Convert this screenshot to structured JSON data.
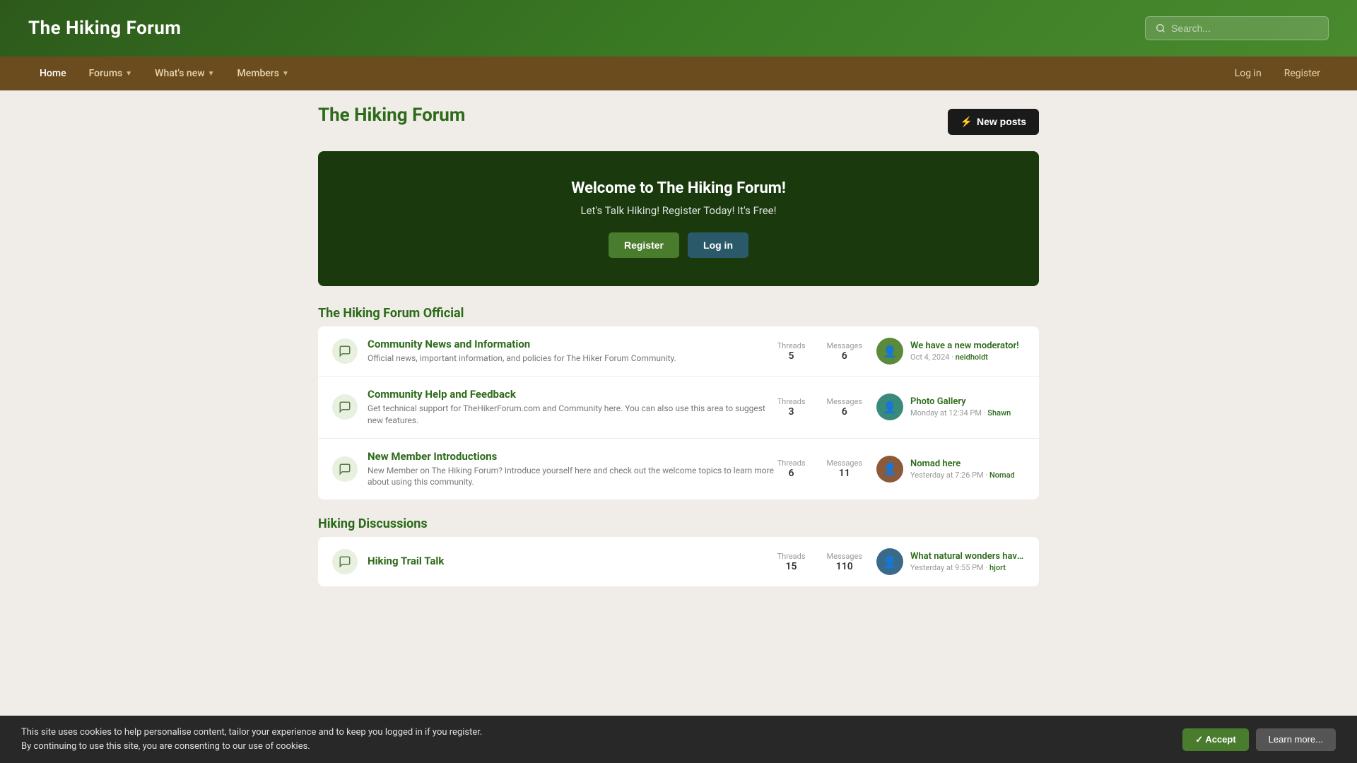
{
  "site": {
    "title": "The Hiking Forum",
    "search_placeholder": "Search..."
  },
  "nav": {
    "items": [
      {
        "id": "home",
        "label": "Home",
        "has_dropdown": false
      },
      {
        "id": "forums",
        "label": "Forums",
        "has_dropdown": true
      },
      {
        "id": "whats_new",
        "label": "What's new",
        "has_dropdown": true
      },
      {
        "id": "members",
        "label": "Members",
        "has_dropdown": true
      }
    ],
    "login_label": "Log in",
    "register_label": "Register"
  },
  "page": {
    "title": "The Hiking Forum",
    "new_posts_label": "New posts"
  },
  "welcome": {
    "heading": "Welcome to The Hiking Forum!",
    "subtext": "Let's Talk Hiking! Register Today! It's Free!",
    "register_label": "Register",
    "login_label": "Log in"
  },
  "sections": [
    {
      "id": "official",
      "title": "The Hiking Forum Official",
      "forums": [
        {
          "id": "community-news",
          "name": "Community News and Information",
          "description": "Official news, important information, and policies for The Hiker Forum Community.",
          "threads": 5,
          "messages": 6,
          "latest_title": "We have a new moderator!",
          "latest_date": "Oct 4, 2024",
          "latest_user": "neidholdt",
          "avatar_color": "green",
          "avatar_glyph": "👤"
        },
        {
          "id": "community-help",
          "name": "Community Help and Feedback",
          "description": "Get technical support for TheHikerForum.com and Community here. You can also use this area to suggest new features.",
          "threads": 3,
          "messages": 6,
          "latest_title": "Photo Gallery",
          "latest_date": "Monday at 12:34 PM",
          "latest_user": "Shawn",
          "avatar_color": "teal",
          "avatar_glyph": "👤"
        },
        {
          "id": "new-member",
          "name": "New Member Introductions",
          "description": "New Member on The Hiking Forum? Introduce yourself here and check out the welcome topics to learn more about using this community.",
          "threads": 6,
          "messages": 11,
          "latest_title": "Nomad here",
          "latest_date": "Yesterday at 7:26 PM",
          "latest_user": "Nomad",
          "avatar_color": "brown",
          "avatar_glyph": "👤"
        }
      ]
    },
    {
      "id": "discussions",
      "title": "Hiking Discussions",
      "forums": [
        {
          "id": "hiking-trail-talk",
          "name": "Hiking Trail Talk",
          "description": "",
          "threads": 15,
          "messages": 110,
          "latest_title": "What natural wonders have you hiked th",
          "latest_date": "Yesterday at 9:55 PM",
          "latest_user": "hjort",
          "avatar_color": "blue",
          "avatar_glyph": "👤"
        }
      ]
    }
  ],
  "cookie": {
    "text_line1": "This site uses cookies to help personalise content, tailor your experience and to keep you logged in if you register.",
    "text_line2": "By continuing to use this site, you are consenting to our use of cookies.",
    "accept_label": "✓ Accept",
    "learn_label": "Learn more..."
  }
}
